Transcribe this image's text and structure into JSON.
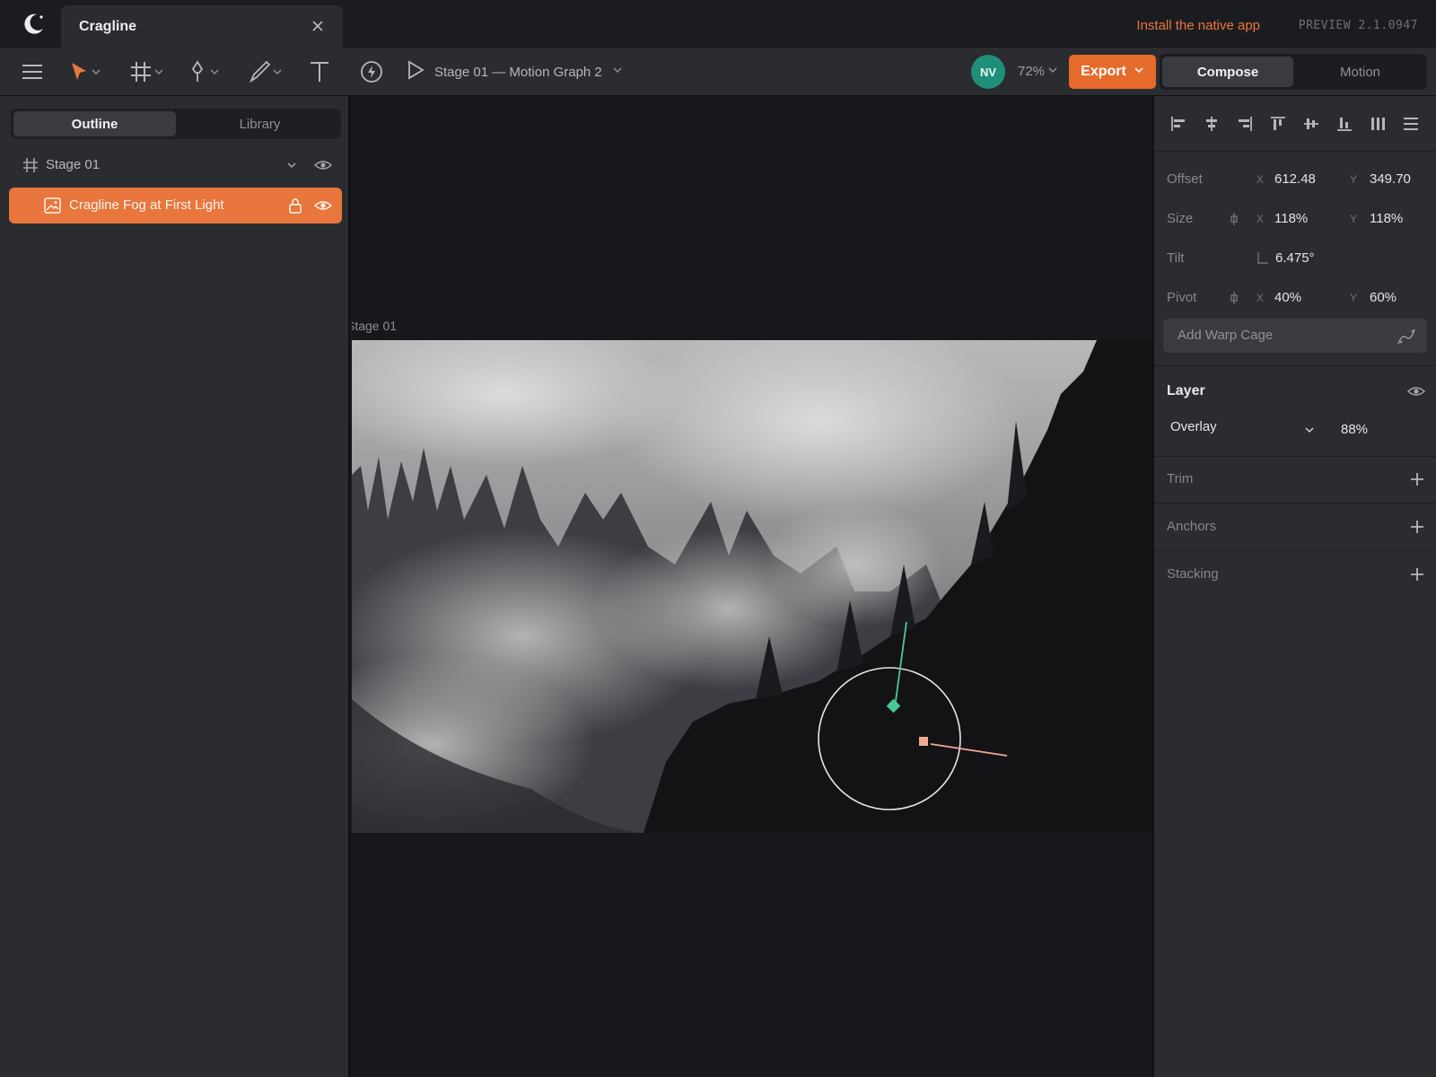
{
  "app": {
    "tab_title": "Cragline",
    "install_link": "Install the native app",
    "version": "PREVIEW 2.1.0947"
  },
  "toolbar": {
    "tools": [
      "menu-icon",
      "pointer-icon",
      "frame-icon",
      "pen-icon",
      "pencil-icon",
      "text-icon",
      "interaction-icon",
      "play-icon"
    ],
    "timeline": "Stage 01 — Motion Graph 2",
    "avatar_initials": "NV",
    "zoom": "72%",
    "export_label": "Export",
    "modes": [
      "Compose",
      "Motion"
    ],
    "active_mode": "Compose",
    "accent": "#e66a2c"
  },
  "left_panel": {
    "tabs": [
      "Outline",
      "Library"
    ],
    "active_tab": "Outline",
    "stage_row": "Stage 01",
    "layer_row": "Cragline Fog at First Light"
  },
  "canvas": {
    "stage_label": "Stage 01"
  },
  "inspector": {
    "offset": {
      "label": "Offset",
      "x_axis": "X",
      "x": "612.48",
      "y_axis": "Y",
      "y": "349.70"
    },
    "size": {
      "label": "Size",
      "x_axis": "X",
      "x": "118%",
      "y_axis": "Y",
      "y": "118%"
    },
    "tilt": {
      "label": "Tilt",
      "value": "6.475°"
    },
    "pivot": {
      "label": "Pivot",
      "x_axis": "X",
      "x": "40%",
      "y_axis": "Y",
      "y": "60%"
    },
    "warp_button": "Add Warp Cage",
    "layer": {
      "heading": "Layer",
      "blend_mode": "Overlay",
      "opacity": "88%"
    },
    "sections": [
      "Trim",
      "Anchors",
      "Stacking"
    ]
  }
}
